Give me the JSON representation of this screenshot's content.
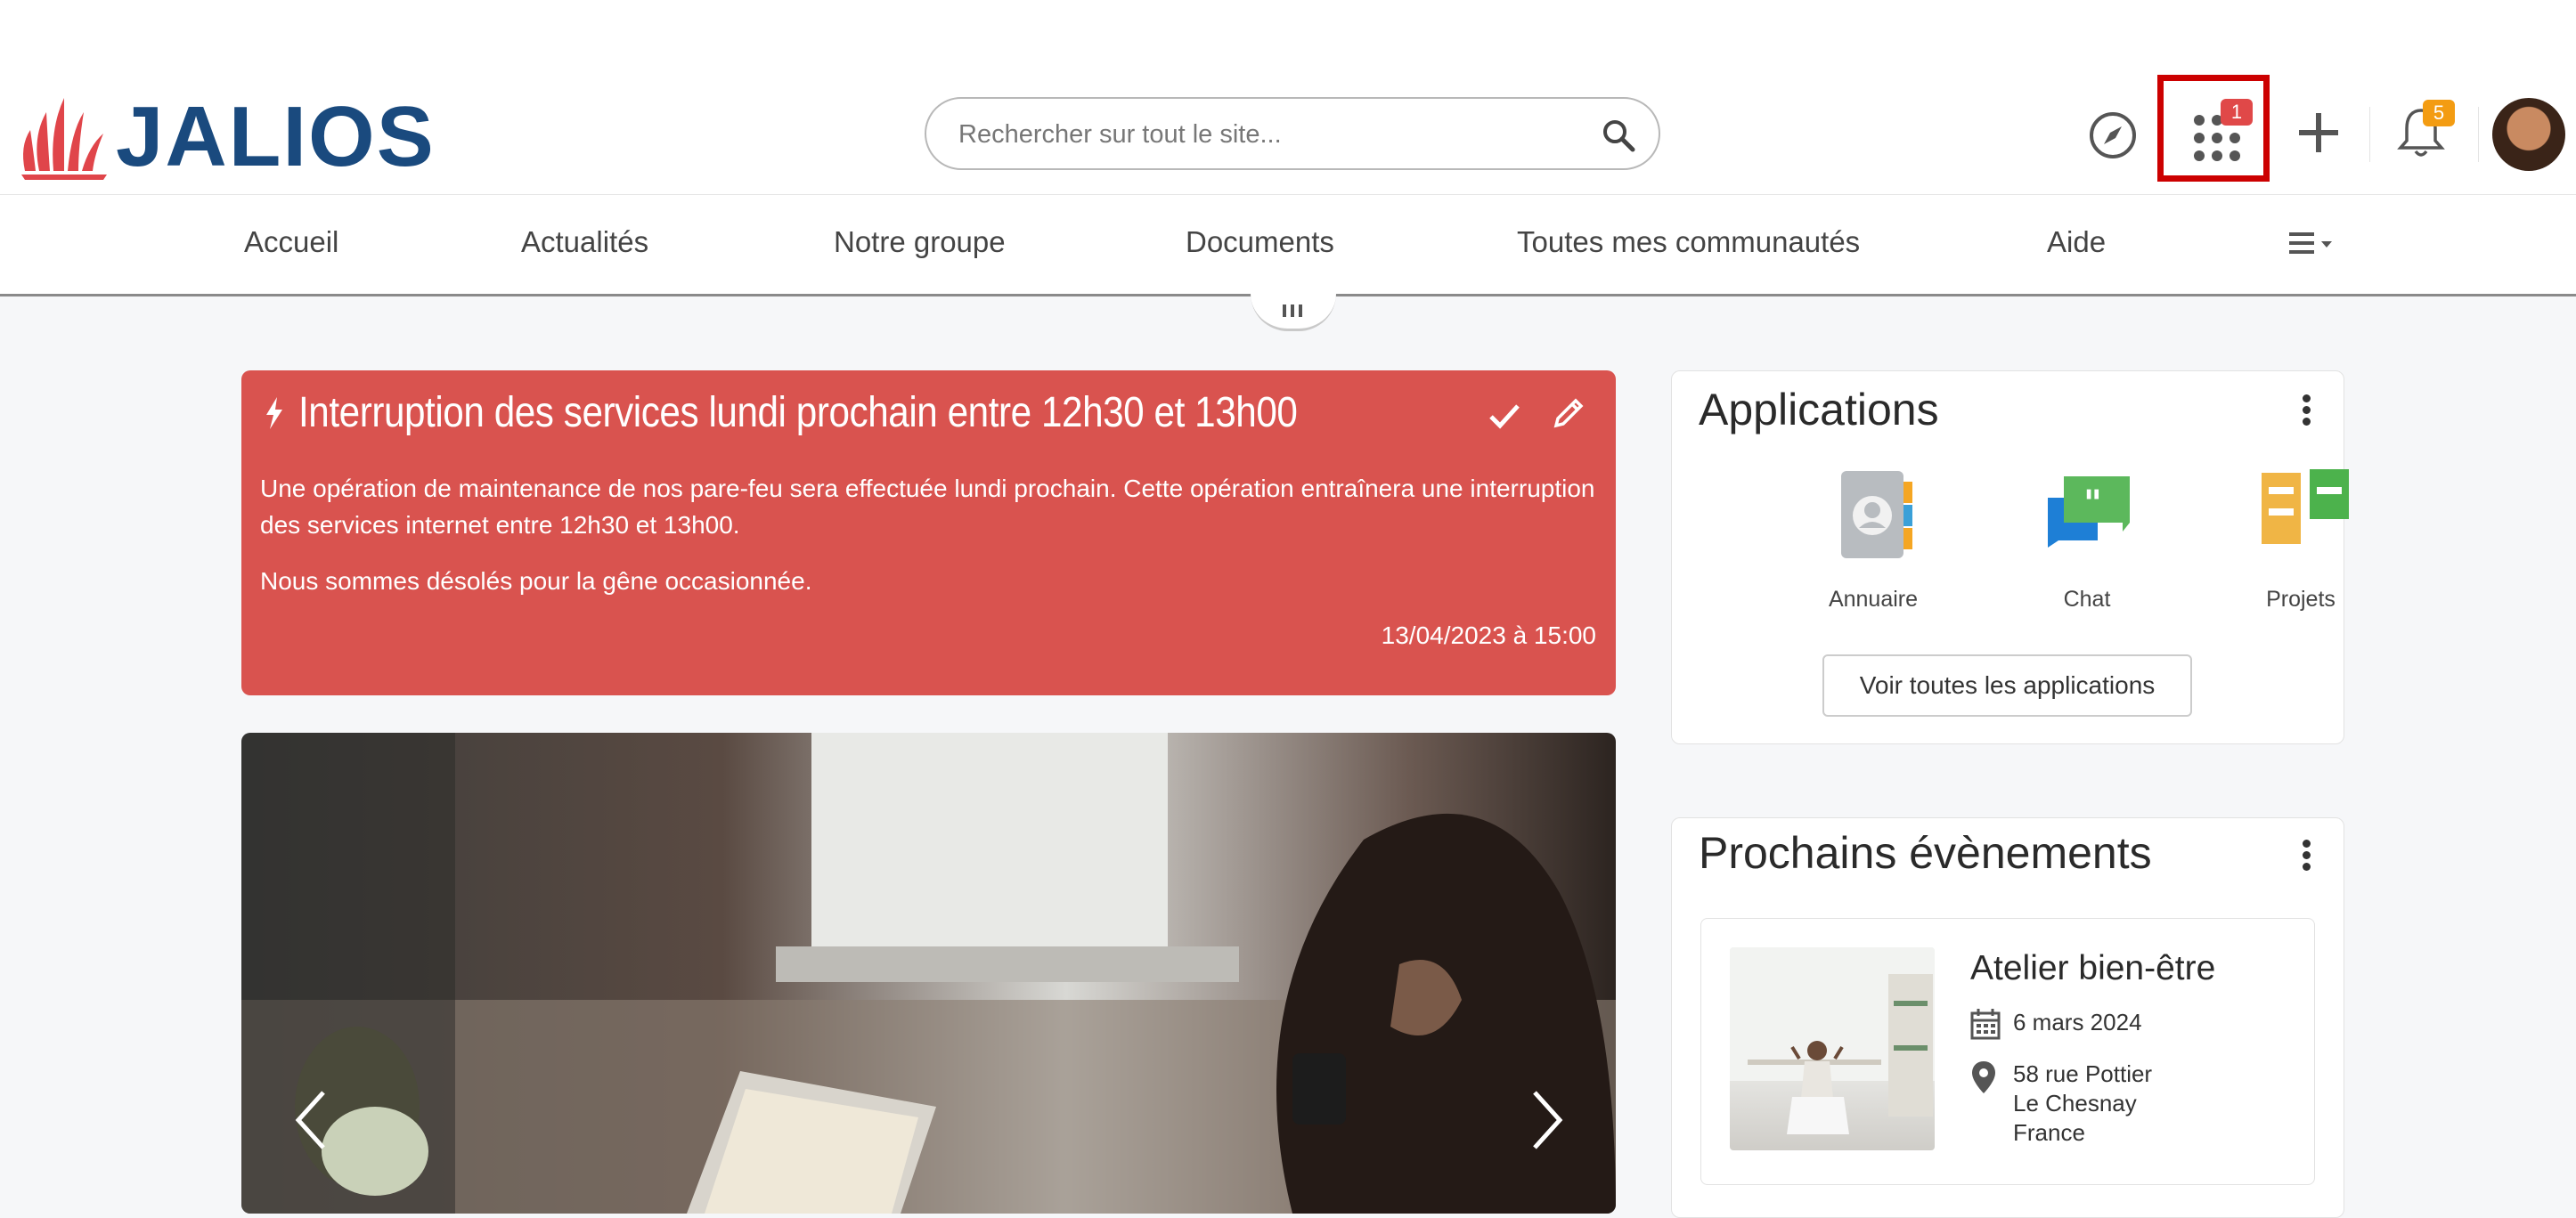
{
  "header": {
    "logo_text": "JALIOS",
    "search": {
      "placeholder": "Rechercher sur tout le site..."
    },
    "apps_badge": "1",
    "notifications_badge": "5",
    "colors": {
      "brand_blue": "#1a4a7e",
      "brand_red": "#e0454a",
      "badge_red": "#e04848",
      "badge_orange": "#f39c12",
      "highlight": "#cc0000"
    }
  },
  "nav": {
    "items": [
      {
        "label": "Accueil"
      },
      {
        "label": "Actualités"
      },
      {
        "label": "Notre groupe"
      },
      {
        "label": "Documents"
      },
      {
        "label": "Toutes mes communautés"
      },
      {
        "label": "Aide"
      }
    ]
  },
  "alert": {
    "title": "Interruption des services lundi prochain entre 12h30 et 13h00",
    "paragraphs": [
      "Une opération de maintenance de nos pare-feu sera effectuée lundi prochain. Cette opération entraînera une interruption des services internet entre 12h30 et 13h00.",
      "Nous sommes désolés pour la gêne occasionnée."
    ],
    "date": "13/04/2023 à 15:00",
    "color": "#d9534f"
  },
  "applications": {
    "title": "Applications",
    "items": [
      {
        "label": "Annuaire"
      },
      {
        "label": "Chat"
      },
      {
        "label": "Projets"
      }
    ],
    "button": "Voir toutes les applications"
  },
  "events": {
    "title": "Prochains évènements",
    "items": [
      {
        "title": "Atelier bien-être",
        "date": "6 mars 2024",
        "address_line1": "58 rue Pottier",
        "address_line2": "Le Chesnay",
        "address_line3": "France"
      }
    ]
  }
}
